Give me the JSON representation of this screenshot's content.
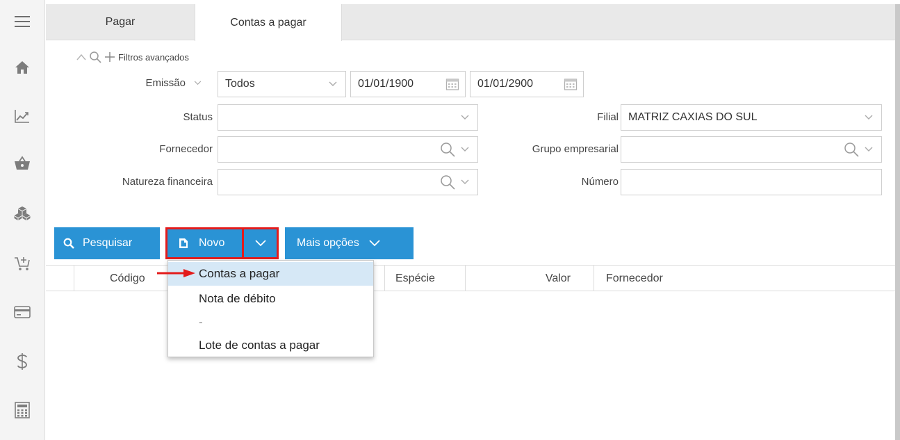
{
  "tabs": [
    {
      "label": "Pagar"
    },
    {
      "label": "Contas a pagar"
    }
  ],
  "filters": {
    "advanced_label": "Filtros avançados",
    "emissao": {
      "label": "Emissão",
      "value": "Todos",
      "date_from": "01/01/1900",
      "date_to": "01/01/2900"
    },
    "status": {
      "label": "Status",
      "value": ""
    },
    "filial": {
      "label": "Filial",
      "value": "MATRIZ CAXIAS DO SUL"
    },
    "fornecedor": {
      "label": "Fornecedor",
      "value": ""
    },
    "grupo": {
      "label": "Grupo empresarial",
      "value": ""
    },
    "natureza": {
      "label": "Natureza financeira",
      "value": ""
    },
    "numero": {
      "label": "Número",
      "value": ""
    }
  },
  "toolbar": {
    "search_label": "Pesquisar",
    "novo_label": "Novo",
    "more_label": "Mais opções"
  },
  "grid": {
    "columns": [
      "Código",
      "Espécie",
      "Valor",
      "Fornecedor"
    ]
  },
  "menu": {
    "items": [
      "Contas a pagar",
      "Nota de débito",
      "-",
      "Lote de contas a pagar"
    ],
    "selected": "Contas a pagar"
  },
  "colors": {
    "accent": "#2a93d5",
    "highlight": "#e31b1b",
    "menu_selected": "#d6e8f6"
  },
  "icons": {
    "rail": [
      "menu-icon",
      "home-icon",
      "chart-icon",
      "basket-icon",
      "boxes-icon",
      "cart-add-icon",
      "card-icon",
      "dollar-icon",
      "calculator-icon"
    ]
  }
}
